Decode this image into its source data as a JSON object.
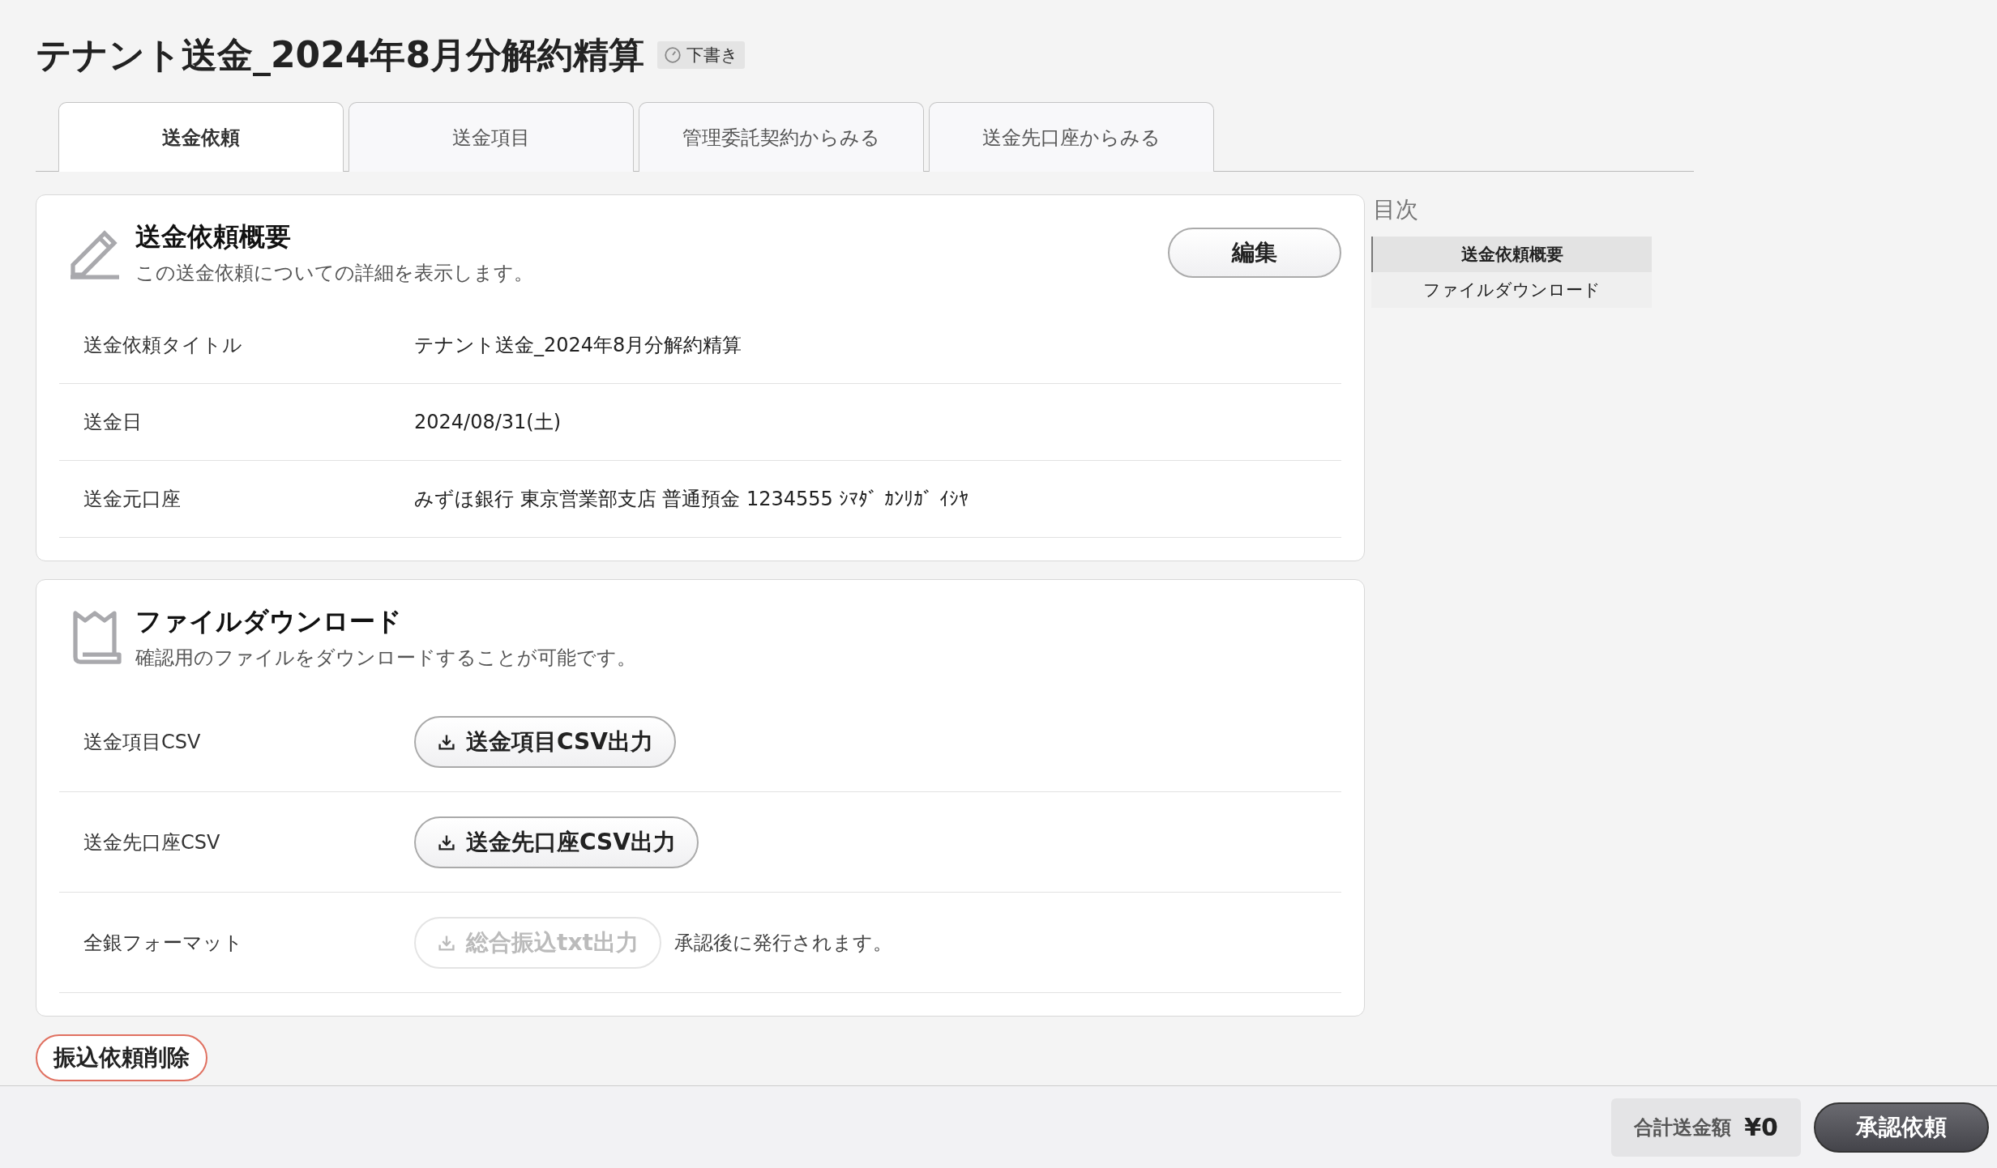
{
  "title": "テナント送金_2024年8月分解約精算",
  "status_badge": {
    "label": "下書き"
  },
  "tabs": [
    {
      "label": "送金依頼",
      "selected": true
    },
    {
      "label": "送金項目",
      "selected": false
    },
    {
      "label": "管理委託契約からみる",
      "selected": false
    },
    {
      "label": "送金先口座からみる",
      "selected": false
    }
  ],
  "sections": [
    {
      "kind": "details",
      "title": "送金依頼概要",
      "description": "この送金依頼についての詳細を表示します。",
      "action_button": "編集",
      "rows": [
        {
          "label": "送金依頼タイトル",
          "value": "テナント送金_2024年8月分解約精算"
        },
        {
          "label": "送金日",
          "value": "2024/08/31(土)"
        },
        {
          "label": "送金元口座",
          "value": "みずほ銀行 東京営業部支店 普通預金 1234555 ｼﾏﾀﾞ ｶﾝﾘｶﾞ ｲｼﾔ"
        }
      ]
    },
    {
      "kind": "downloads",
      "title": "ファイルダウンロード",
      "description": "確認用のファイルをダウンロードすることが可能です。",
      "rows": [
        {
          "label": "送金項目CSV",
          "button": {
            "label": "送金項目CSV出力",
            "disabled": false
          }
        },
        {
          "label": "送金先口座CSV",
          "button": {
            "label": "送金先口座CSV出力",
            "disabled": false
          }
        },
        {
          "label": "全銀フォーマット",
          "button": {
            "label": "総合振込txt出力",
            "disabled": true
          },
          "note": "承認後に発行されます。"
        }
      ]
    }
  ],
  "delete_button": "振込依頼削除",
  "toc": {
    "title": "目次",
    "items": [
      {
        "label": "送金依頼概要",
        "selected": true
      },
      {
        "label": "ファイルダウンロード",
        "selected": false
      }
    ]
  },
  "footer": {
    "total_label": "合計送金額",
    "total_value": "¥0",
    "submit_button": "承認依頼"
  }
}
